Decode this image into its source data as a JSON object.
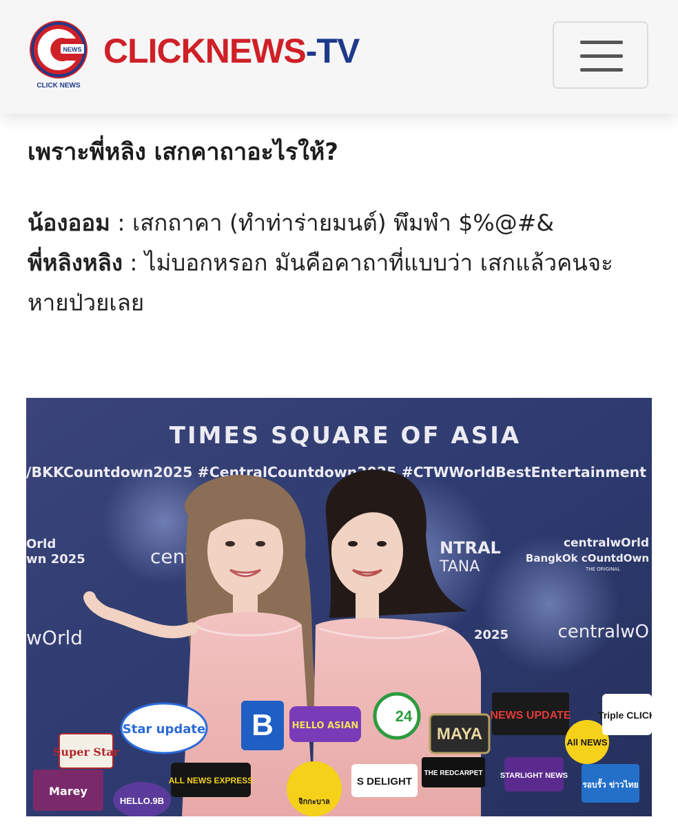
{
  "header": {
    "brand_main": "CLICKNEWS",
    "brand_dash": "-",
    "brand_tv": "TV",
    "logo_badge": "NEWS",
    "logo_caption": "CLICK NEWS",
    "menu_icon": "hamburger-icon"
  },
  "article": {
    "headline": "เพราะพี่หลิง เสกคาถาอะไรให้?",
    "lines": [
      {
        "speaker": "น้องออม",
        "sep": " : ",
        "text": "เสกถาคา (ทำท่าร่ายมนต์) พึมพำ $%@#&"
      },
      {
        "speaker": "พี่หลิงหลิง",
        "sep": " : ",
        "text": "ไม่บอกหรอก มันคือคาถาที่แบบว่า เสกแล้วคนจะหายป่วยเลย"
      }
    ]
  },
  "photo": {
    "backdrop_top": "TIMES SQUARE OF ASIA",
    "backdrop_hashtags": "/BKKCountdown2025 #CentralCountdown2025 #CTWWorldBestEntertainment",
    "backdrop_left_1": "Orld",
    "backdrop_left_2": "wn 2025",
    "backdrop_left_3": "wOrld",
    "backdrop_center": "centr",
    "backdrop_central_1": "NTRAL",
    "backdrop_central_2": "TANA",
    "backdrop_right_1": "centralwOrld",
    "backdrop_right_2": "BangkOk cOuntdOwn",
    "backdrop_right_3": "THE ORIGINAL",
    "backdrop_right_4": "centralwO",
    "backdrop_year": "2025",
    "mics": [
      "Star update",
      "B",
      "HELLO ASIAN",
      "24",
      "MAYA",
      "NEWS UPDATE",
      "All NEWS",
      "Triple CLICK",
      "Super Star",
      "Marey",
      "ALL NEWS EXPRESS",
      "S DELIGHT",
      "THE REDCARPET",
      "STARLIGHT NEWS",
      "รอบรั้ว ข่าวไทย",
      "HELLO.9B",
      "จิกกะบาล"
    ]
  }
}
